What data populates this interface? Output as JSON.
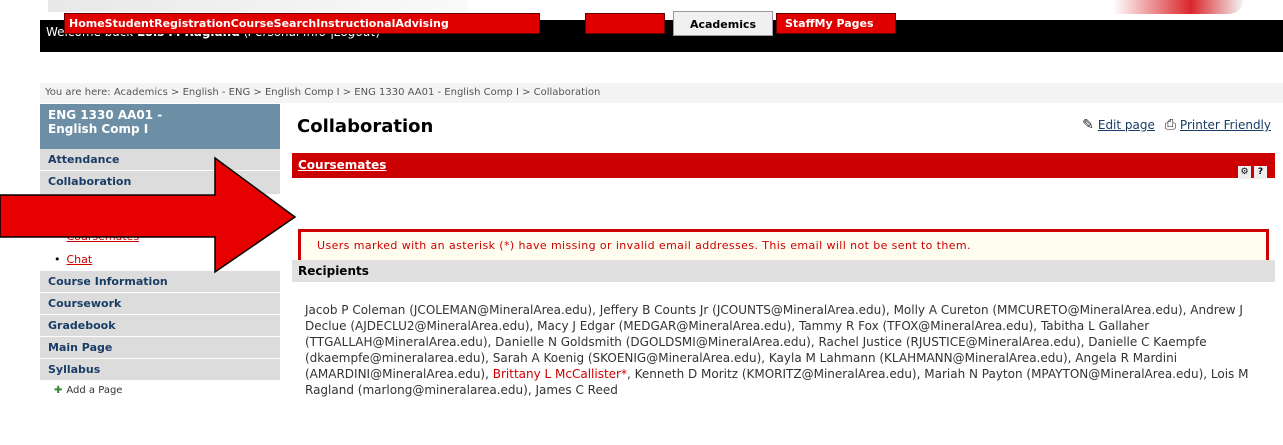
{
  "header": {
    "welcome_prefix": "Welcome back",
    "user_name": "Lois M Ragland",
    "personal_info": "Personal Info",
    "logout": "Logout"
  },
  "tabs": [
    {
      "label": "HomeStudentRegistrationCourseSearchInstructionalAdvising"
    },
    {
      "label": ""
    },
    {
      "label": "Academics"
    },
    {
      "label": "StaffMy Pages"
    }
  ],
  "breadcrumb": "You are here:  Academics > English - ENG > English Comp I > ENG 1330 AA01 - English Comp I > Collaboration",
  "sidebar": {
    "course_title_line1": "ENG 1330 AA01 -",
    "course_title_line2": "English Comp I",
    "items": {
      "attendance": "Attendance",
      "collaboration": "Collaboration",
      "coursemates": "Coursemates",
      "chat": "Chat",
      "course_information": "Course Information",
      "coursework": "Coursework",
      "gradebook": "Gradebook",
      "main_page": "Main Page",
      "syllabus": "Syllabus",
      "add_page": "Add a Page"
    }
  },
  "main": {
    "title": "Collaboration",
    "edit_page": "Edit page",
    "printer_friendly": "Printer Friendly",
    "section_title": "Coursemates",
    "alert": "Users marked with an asterisk (*) have missing or invalid email addresses. This email will not be sent to them.",
    "recipients_heading": "Recipients",
    "recipients_part1": "Jacob P Coleman (JCOLEMAN@MineralArea.edu), Jeffery B Counts Jr (JCOUNTS@MineralArea.edu), Molly A Cureton (MMCURETO@MineralArea.edu), Andrew J Declue (AJDECLU2@MineralArea.edu), Macy J Edgar (MEDGAR@MineralArea.edu), Tammy R Fox (TFOX@MineralArea.edu), Tabitha L Gallaher (TTGALLAH@MineralArea.edu), Danielle N Goldsmith (DGOLDSMI@MineralArea.edu), Rachel Justice (RJUSTICE@MineralArea.edu), Danielle C Kaempfe (dkaempfe@mineralarea.edu), Sarah A Koenig (SKOENIG@MineralArea.edu), Kayla M Lahmann (KLAHMANN@MineralArea.edu), Angela R Mardini (AMARDINI@MineralArea.edu), ",
    "recipients_flagged": "Brittany L McCallister*",
    "recipients_part2": ", Kenneth D Moritz (KMORITZ@MineralArea.edu), Mariah N Payton (MPAYTON@MineralArea.edu), Lois M Ragland (marlong@mineralarea.edu), James C Reed"
  },
  "colors": {
    "accent_red": "#cc0000",
    "nav_blue": "#6d8fa6",
    "arrow_red": "#e60000"
  }
}
